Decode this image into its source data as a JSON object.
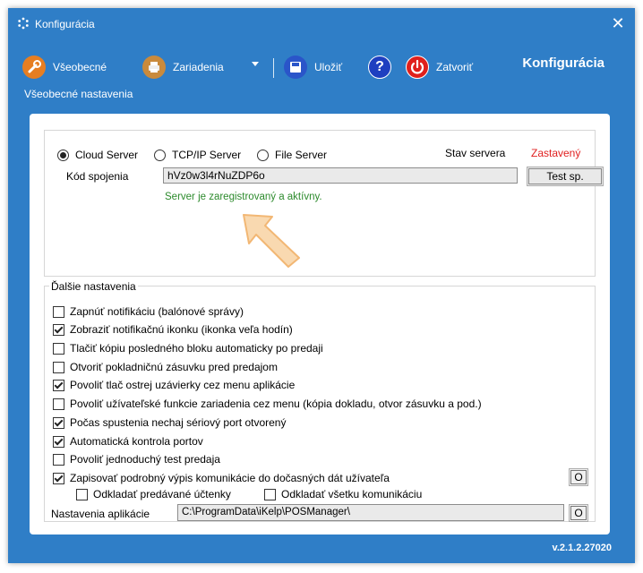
{
  "window": {
    "title": "Konfigurácia",
    "close_glyph": "✕"
  },
  "toolbar": {
    "items": [
      {
        "label": "Všeobecné",
        "icon": "wrench-icon",
        "color": "#e67e22"
      },
      {
        "label": "Zariadenia",
        "icon": "printer-icon",
        "color": "#c98a3c"
      },
      {
        "label": "Uložiť",
        "icon": "floppy-icon",
        "color": "#2a55c9"
      },
      {
        "label": "",
        "icon": "help-icon",
        "color": "#1e3fc0"
      },
      {
        "label": "Zatvoriť",
        "icon": "power-icon",
        "color": "#e0201c"
      }
    ],
    "help_glyph": "?"
  },
  "header": {
    "title": "Konfigurácia",
    "subtitle": "Všeobecné nastavenia"
  },
  "server": {
    "options": [
      {
        "label": "Cloud Server",
        "selected": true
      },
      {
        "label": "TCP/IP Server",
        "selected": false
      },
      {
        "label": "File Server",
        "selected": false
      }
    ],
    "status_label": "Stav servera",
    "status_value": "Zastavený",
    "code_label": "Kód spojenia",
    "code_value": "hVz0w3l4rNuZDP6o",
    "test_button": "Test sp.",
    "message": "Server je zaregistrovaný a aktívny."
  },
  "settings": {
    "legend": "Ďalšie nastavenia",
    "checkboxes": [
      {
        "label": "Zapnúť notifikáciu (balónové správy)",
        "checked": false
      },
      {
        "label": "Zobraziť notifikačnú ikonku (ikonka veľa hodín)",
        "checked": true
      },
      {
        "label": "Tlačiť kópiu posledného bloku automaticky po predaji",
        "checked": false
      },
      {
        "label": "Otvoriť pokladničnú zásuvku pred predajom",
        "checked": false
      },
      {
        "label": "Povoliť tlač ostrej uzávierky cez menu aplikácie",
        "checked": true
      },
      {
        "label": "Povoliť užívateľské funkcie zariadenia cez menu (kópia dokladu, otvor zásuvku a pod.)",
        "checked": false
      },
      {
        "label": "Počas spustenia nechaj sériový port otvorený",
        "checked": true
      },
      {
        "label": "Automatická kontrola portov",
        "checked": true
      },
      {
        "label": "Povoliť jednoduchý test predaja",
        "checked": false
      },
      {
        "label": "Zapisovať podrobný výpis komunikácie do dočasných dát užívateľa",
        "checked": true
      }
    ],
    "sub_checkboxes": [
      {
        "label": "Odkladať predávané účtenky",
        "checked": false
      },
      {
        "label": "Odkladať všetku komunikáciu",
        "checked": false
      }
    ],
    "o_button": "O",
    "app_label": "Nastavenia aplikácie",
    "app_path": "C:\\ProgramData\\iKelp\\POSManager\\",
    "app_o_button": "O"
  },
  "footer": {
    "version": "v.2.1.2.27020"
  }
}
